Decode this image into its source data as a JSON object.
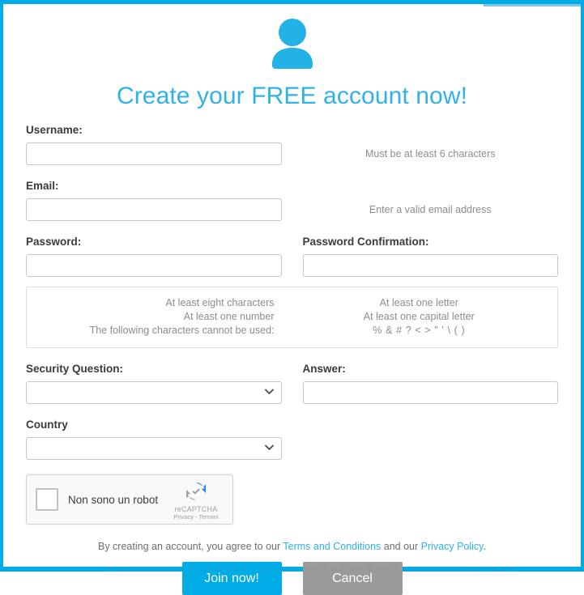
{
  "theme": {
    "accent": "#00ace6",
    "title_color": "#2fb2e8",
    "label_color": "#3b3b3b",
    "hint_color": "#8d8d8d",
    "cancel_color": "#9a9a9a"
  },
  "header": {
    "avatar_icon": "user-avatar-icon",
    "title": "Create your FREE account now!"
  },
  "fields": {
    "username": {
      "label": "Username:",
      "value": "",
      "placeholder": "",
      "hint": "Must be at least 6 characters"
    },
    "email": {
      "label": "Email:",
      "value": "",
      "placeholder": "",
      "hint": "Enter a valid email address"
    },
    "password": {
      "label": "Password:",
      "value": "",
      "placeholder": ""
    },
    "password_confirmation": {
      "label": "Password Confirmation:",
      "value": "",
      "placeholder": ""
    },
    "security_question": {
      "label": "Security Question:",
      "value": "",
      "options": [
        ""
      ]
    },
    "answer": {
      "label": "Answer:",
      "value": "",
      "placeholder": ""
    },
    "country": {
      "label": "Country",
      "value": "",
      "options": [
        ""
      ]
    }
  },
  "password_rules": {
    "left": [
      "At least eight characters",
      "At least one number",
      "The following characters cannot be used:"
    ],
    "right": [
      "At least one letter",
      "At least one capital letter",
      "% & # ? < > \" ' \\ ( )"
    ]
  },
  "recaptcha": {
    "checkbox_icon": "recaptcha-checkbox",
    "label": "Non sono un robot",
    "logo_icon": "recaptcha-logo-icon",
    "brand": "reCAPTCHA",
    "legal": "Privacy - Termini"
  },
  "terms": {
    "prefix": "By creating an account, you agree to our ",
    "terms_link": "Terms and Conditions",
    "middle": " and our ",
    "privacy_link": "Privacy Policy",
    "suffix": "."
  },
  "actions": {
    "submit_label": "Join now!",
    "cancel_label": "Cancel"
  }
}
